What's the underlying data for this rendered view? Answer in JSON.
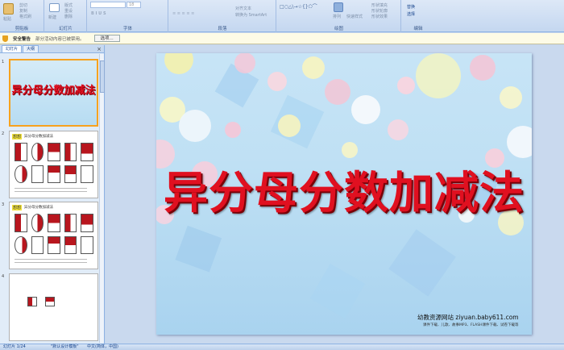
{
  "ribbon": {
    "groups": [
      {
        "label": "剪贴板",
        "items": [
          "粘贴",
          "剪切",
          "复制",
          "格式刷"
        ]
      },
      {
        "label": "幻灯片",
        "items": [
          "新建",
          "版式",
          "重设",
          "删除"
        ]
      },
      {
        "label": "字体",
        "items": [
          "18"
        ]
      },
      {
        "label": "段落",
        "items": [
          "对齐文本",
          "转换为 SmartArt"
        ]
      },
      {
        "label": "绘图",
        "items": [
          "排列",
          "快速样式",
          "形状填充",
          "形状轮廓",
          "形状效果"
        ]
      },
      {
        "label": "编辑",
        "items": [
          "替换",
          "选择"
        ]
      }
    ]
  },
  "security": {
    "heading": "安全警告",
    "message": "部分活动内容已被禁用。",
    "options_button": "选项..."
  },
  "panel": {
    "tabs": [
      "幻灯片",
      "大纲"
    ],
    "close": "×",
    "slides": [
      {
        "number": "1",
        "title": "异分母分数加减法"
      },
      {
        "number": "2",
        "badge": "想想",
        "heading": "异分母分数加减法"
      },
      {
        "number": "3",
        "badge": "想想",
        "heading": "异分母分数加减法"
      },
      {
        "number": "4"
      }
    ]
  },
  "slide": {
    "title": "异分母分数加减法",
    "footer_line1": "幼教资源网站 ziyuan.baby611.com",
    "footer_line2": "课件下载、儿歌、故事MP3、FLASH课件下载、试卷下载等"
  },
  "status": {
    "slide_count": "幻灯片 1/24",
    "theme": "\"默认设计模板\"",
    "language": "中文(简体，中国)"
  },
  "colors": {
    "accent": "#f7a21e",
    "title_red": "#e01020",
    "ribbon": "#c4d7f0"
  }
}
